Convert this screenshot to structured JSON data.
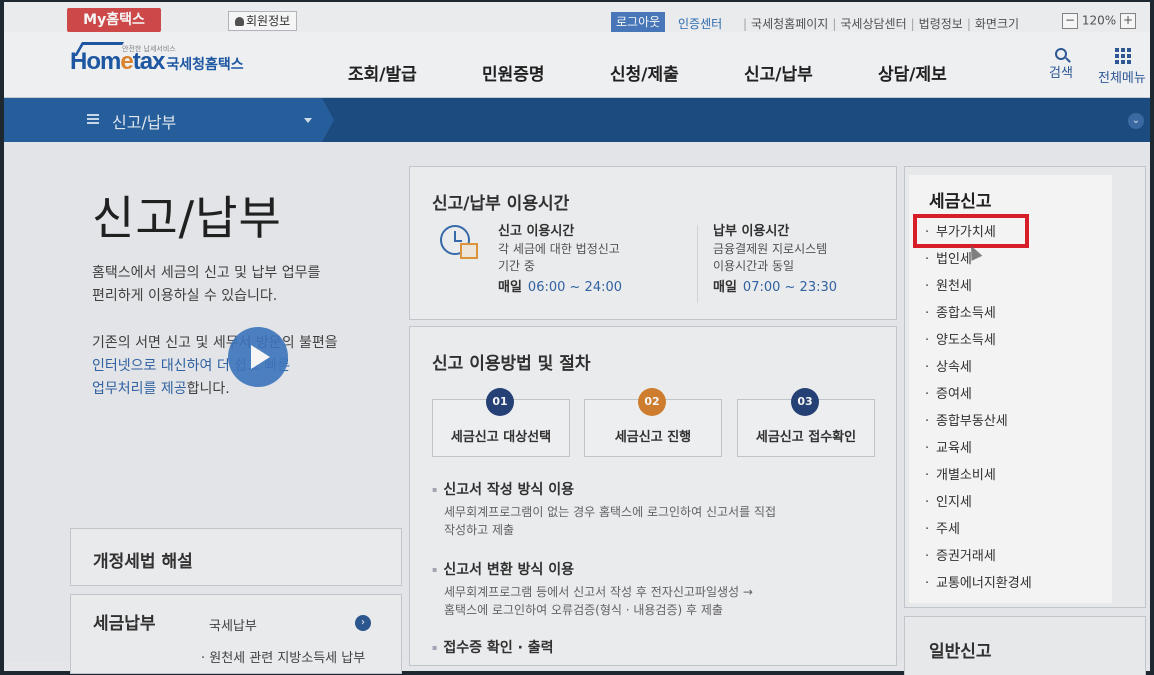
{
  "topbar": {
    "my_tax": "My홈택스",
    "member_info": "회원정보",
    "logout": "로그아웃",
    "cert_center": "인증센터",
    "links": [
      "국세청홈페이지",
      "국세상담센터",
      "법령정보",
      "화면크기"
    ],
    "zoom_level": "120%",
    "zoom_minus": "−",
    "zoom_plus": "+"
  },
  "header": {
    "logo_home": "Hom",
    "logo_e": "e",
    "logo_tax": "tax",
    "logo_nts": "국세청홈택스",
    "logo_small": "안전한 납세서비스",
    "nav": [
      "조회/발급",
      "민원증명",
      "신청/제출",
      "신고/납부",
      "상담/제보"
    ],
    "search_label": "검색",
    "all_menu_label": "전체메뉴"
  },
  "location": {
    "current": "신고/납부"
  },
  "main": {
    "title": "신고/납부",
    "desc1_line1": "홈택스에서 세금의 신고 및 납부 업무를",
    "desc1_line2": "편리하게 이용하실 수 있습니다.",
    "desc2_line1": "기존의 서면 신고 및 세무서 방문의 불편을",
    "desc2_line2": "인터넷으로 대신하여 더 쉽고 빠른",
    "desc2_line3_blue": "업무처리를 제공",
    "desc2_line3_rest": "합니다.",
    "box_law": "개정세법 해설",
    "box_pay_title": "세금납부",
    "box_pay_sub": "국세납부",
    "box_pay_sub2": "· 원천세 관련 지방소득세 납부"
  },
  "usage_time": {
    "title": "신고/납부 이용시간",
    "report_title": "신고 이용시간",
    "report_desc1": "각 세금에 대한 법정신고",
    "report_desc2": "기간 중",
    "report_daily": "매일",
    "report_time": "06:00 ~ 24:00",
    "pay_title": "납부 이용시간",
    "pay_desc1": "금융결제원 지로시스템",
    "pay_desc2": "이용시간과 동일",
    "pay_daily": "매일",
    "pay_time": "07:00 ~ 23:30"
  },
  "procedure": {
    "title": "신고 이용방법 및 절차",
    "steps": [
      {
        "num": "01",
        "label": "세금신고 대상선택"
      },
      {
        "num": "02",
        "label": "세금신고 진행"
      },
      {
        "num": "03",
        "label": "세금신고 접수확인"
      }
    ],
    "sec1_title": "신고서 작성 방식 이용",
    "sec1_desc1": "세무회계프로그램이 없는 경우 홈택스에 로그인하여 신고서를 직접",
    "sec1_desc2": "작성하고 제출",
    "sec2_title": "신고서 변환 방식 이용",
    "sec2_desc1": "세무회계프로그램 등에서 신고서 작성 후 전자신고파일생성 →",
    "sec2_desc2": "홈택스에 로그인하여 오류검증(형식 · 내용검증) 후 제출",
    "sec3_title": "접수증 확인 · 출력"
  },
  "tax_report": {
    "title": "세금신고",
    "items": [
      "부가가치세",
      "법인세",
      "원천세",
      "종합소득세",
      "양도소득세",
      "상속세",
      "증여세",
      "종합부동산세",
      "교육세",
      "개별소비세",
      "인지세",
      "주세",
      "증권거래세",
      "교통에너지환경세"
    ]
  },
  "general_report": {
    "title": "일반신고"
  },
  "colors": {
    "brand_blue": "#1f5aa8",
    "nav_bar": "#1e4f86",
    "highlight_red": "#e0202a",
    "my_tax_red": "#d64b4b",
    "step_orange": "#d6832f",
    "step_navy": "#27437a"
  }
}
